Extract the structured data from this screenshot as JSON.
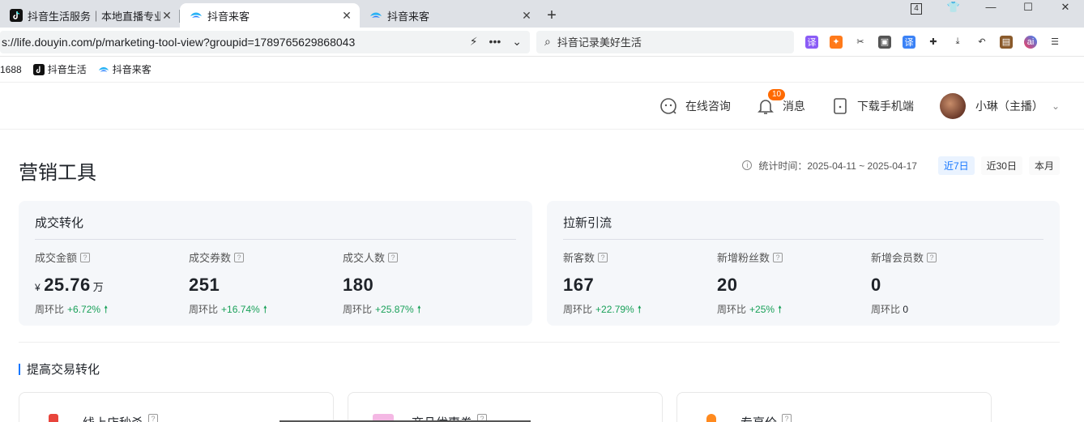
{
  "browser": {
    "tabs": [
      {
        "title": "抖音生活服务｜本地直播专业",
        "active": false
      },
      {
        "title": "抖音来客",
        "active": true
      },
      {
        "title": "抖音来客",
        "active": false
      }
    ],
    "new_tab": "+",
    "window_badge": "4",
    "url": "s://life.douyin.com/p/marketing-tool-view?groupid=1789765629868043",
    "search_placeholder": "抖音记录美好生活",
    "bookmarks": [
      {
        "label": "1688"
      },
      {
        "label": "抖音生活"
      },
      {
        "label": "抖音来客"
      }
    ]
  },
  "header": {
    "consult_label": "在线咨询",
    "message_label": "消息",
    "message_count": "10",
    "download_label": "下载手机端",
    "user_name": "小琳（主播）"
  },
  "page": {
    "title": "营销工具",
    "range_label": "统计时间：2025-04-11 ~ 2025-04-17",
    "range_buttons": [
      "近7日",
      "近30日",
      "本月"
    ],
    "active_range": "近7日"
  },
  "cards": [
    {
      "title": "成交转化",
      "metrics": [
        {
          "label": "成交金额",
          "currency": "¥",
          "value": "25.76",
          "unit": "万",
          "cmp_label": "周环比",
          "cmp_value": "+6.72%"
        },
        {
          "label": "成交券数",
          "value": "251",
          "cmp_label": "周环比",
          "cmp_value": "+16.74%"
        },
        {
          "label": "成交人数",
          "value": "180",
          "cmp_label": "周环比",
          "cmp_value": "+25.87%"
        }
      ]
    },
    {
      "title": "拉新引流",
      "metrics": [
        {
          "label": "新客数",
          "value": "167",
          "cmp_label": "周环比",
          "cmp_value": "+22.79%"
        },
        {
          "label": "新增粉丝数",
          "value": "20",
          "cmp_label": "周环比",
          "cmp_value": "+25%"
        },
        {
          "label": "新增会员数",
          "value": "0",
          "cmp_label": "周环比",
          "cmp_value": "0"
        }
      ]
    }
  ],
  "section": {
    "title": "提高交易转化",
    "tools": [
      {
        "label": "线上店秒杀",
        "color": "#e8453c"
      },
      {
        "label": "商品优惠券",
        "color": "#f4b8e4"
      },
      {
        "label": "专享价",
        "color": "#ff8a1f"
      }
    ]
  },
  "colors": {
    "accent": "#1677ff",
    "up": "#18a058",
    "badge": "#ff6a00"
  }
}
